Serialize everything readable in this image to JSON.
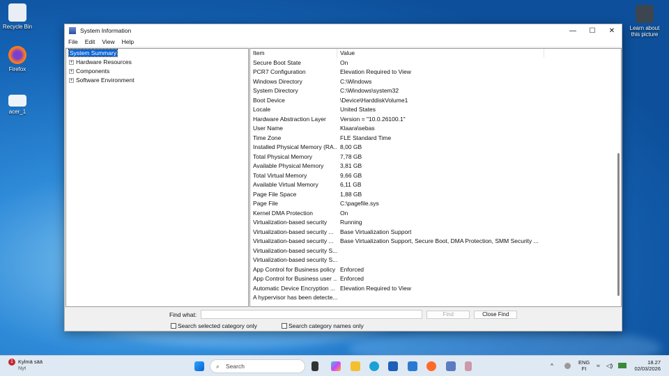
{
  "desktop": {
    "icons": [
      {
        "label": "Recycle Bin"
      },
      {
        "label": "Firefox"
      },
      {
        "label": "acer_1"
      }
    ],
    "spotlight": "Learn about this picture"
  },
  "window": {
    "title": "System Information",
    "menu": [
      "File",
      "Edit",
      "View",
      "Help"
    ],
    "tree": [
      {
        "label": "System Summary",
        "selected": true
      },
      {
        "label": "Hardware Resources"
      },
      {
        "label": "Components"
      },
      {
        "label": "Software Environment"
      }
    ],
    "columns": [
      "Item",
      "Value"
    ],
    "rows": [
      [
        "Secure Boot State",
        "On"
      ],
      [
        "PCR7 Configuration",
        "Elevation Required to View"
      ],
      [
        "Windows Directory",
        "C:\\Windows"
      ],
      [
        "System Directory",
        "C:\\Windows\\system32"
      ],
      [
        "Boot Device",
        "\\Device\\HarddiskVolume1"
      ],
      [
        "Locale",
        "United States"
      ],
      [
        "Hardware Abstraction Layer",
        "Version = \"10.0.26100.1\""
      ],
      [
        "User Name",
        "Klaara\\sebas"
      ],
      [
        "Time Zone",
        "FLE Standard Time"
      ],
      [
        "Installed Physical Memory (RA...",
        "8,00 GB"
      ],
      [
        "Total Physical Memory",
        "7,78 GB"
      ],
      [
        "Available Physical Memory",
        "3,81 GB"
      ],
      [
        "Total Virtual Memory",
        "9,66 GB"
      ],
      [
        "Available Virtual Memory",
        "6,11 GB"
      ],
      [
        "Page File Space",
        "1,88 GB"
      ],
      [
        "Page File",
        "C:\\pagefile.sys"
      ],
      [
        "Kernel DMA Protection",
        "On"
      ],
      [
        "Virtualization-based security",
        "Running"
      ],
      [
        "Virtualization-based security ...",
        "Base Virtualization Support"
      ],
      [
        "Virtualization-based security ...",
        "Base Virtualization Support, Secure Boot, DMA Protection, SMM Security ..."
      ],
      [
        "Virtualization-based security S...",
        ""
      ],
      [
        "Virtualization-based security S...",
        ""
      ],
      [
        "App Control for Business policy",
        "Enforced"
      ],
      [
        "App Control for Business user ...",
        "Enforced"
      ],
      [
        "Automatic Device Encryption ...",
        "Elevation Required to View"
      ],
      [
        "A hypervisor has been detecte...",
        ""
      ]
    ],
    "find": {
      "label": "Find what:",
      "value": "",
      "find_btn": "Find",
      "close_btn": "Close Find",
      "chk1": "Search selected category only",
      "chk2": "Search category names only"
    }
  },
  "taskbar": {
    "weather_title": "Kylmä sää",
    "weather_sub": "Nyt",
    "weather_badge": "1",
    "search": "Search",
    "lang": "ENG",
    "region": "FI",
    "time": "18.27",
    "date": "02/03/2026"
  }
}
